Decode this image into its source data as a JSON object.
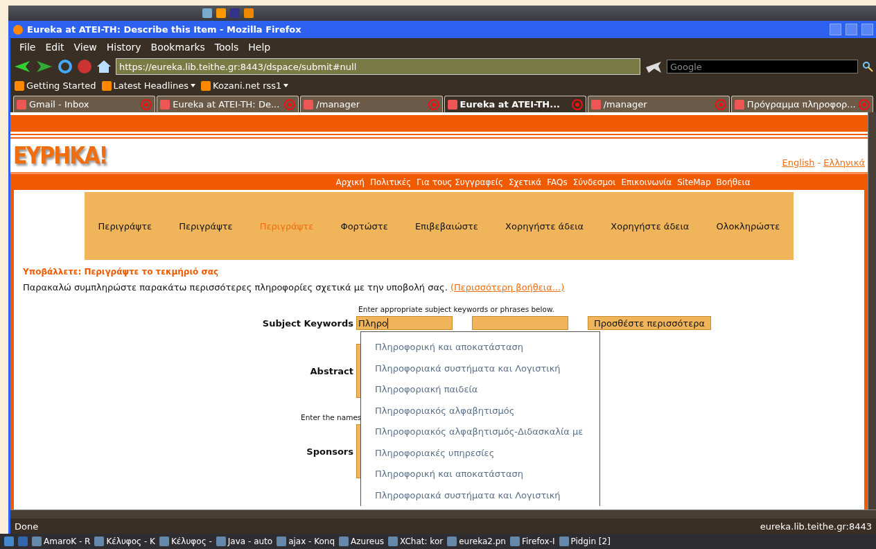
{
  "window": {
    "title": "Eureka at ATEI-TH: Describe this Item - Mozilla Firefox"
  },
  "menu": [
    "File",
    "Edit",
    "View",
    "History",
    "Bookmarks",
    "Tools",
    "Help"
  ],
  "navigation": {
    "url": "https://eureka.lib.teithe.gr:8443/dspace/submit#null",
    "search_placeholder": "Google"
  },
  "bookmarks": [
    {
      "label": "Getting Started",
      "has_menu": false
    },
    {
      "label": "Latest Headlines",
      "has_menu": true
    },
    {
      "label": "Kozani.net rss1",
      "has_menu": true
    }
  ],
  "tabs": [
    {
      "label": "Gmail - Inbox",
      "selected": false
    },
    {
      "label": "Eureka at ATEI-TH: De...",
      "selected": false
    },
    {
      "label": "/manager",
      "selected": false
    },
    {
      "label": "Eureka at ATEI-TH...",
      "selected": true
    },
    {
      "label": "/manager",
      "selected": false
    },
    {
      "label": "Πρόγραμμα πληροφορ...",
      "selected": false
    }
  ],
  "page": {
    "logo": "ΕΥΡΗΚΑ!",
    "languages": {
      "first": "English",
      "separator": "-",
      "second": "Ελληνικά"
    },
    "nav_links": [
      "Αρχική",
      "Πολιτικές",
      "Για τους Συγγραφείς",
      "Σχετικά",
      "FAQs",
      "Σύνδεσμοι",
      "Επικοινωνία",
      "SiteMap",
      "Βοήθεια"
    ],
    "steps": [
      {
        "label": "Περιγράψτε",
        "selected": false
      },
      {
        "label": "Περιγράψτε",
        "selected": false
      },
      {
        "label": "Περιγράψτε",
        "selected": true
      },
      {
        "label": "Φορτώστε",
        "selected": false
      },
      {
        "label": "Επιβεβαιώστε",
        "selected": false
      },
      {
        "label": "Χορηγήστε άδεια",
        "selected": false
      },
      {
        "label": "Χορηγήστε άδεια",
        "selected": false
      },
      {
        "label": "Ολοκληρώστε",
        "selected": false
      }
    ],
    "heading": "Υποβάλλετε: Περιγράψτε το τεκμήριό σας",
    "intro": "Παρακαλώ συμπληρώστε παρακάτω περισσότερες πληροφορίες σχετικά με την υποβολή σας.",
    "help_link": "(Περισσότερη βοήθεια...)",
    "keywords": {
      "hint": "Enter appropriate subject keywords or phrases below.",
      "label": "Subject Keywords",
      "value": "Πληρο",
      "button": "Προσθέστε περισσότερα"
    },
    "suggestions": [
      "Πληροφορική και αποκατάσταση",
      "Πληροφοριακά συστήματα και Λογιστική",
      "Πληροφοριακή παιδεία",
      "Πληροφοριακός αλφαβητισμός",
      "Πληροφοριακός αλφαβητισμός-Διδασκαλία με",
      "Πληροφοριακές υπηρεσίες",
      "Πληροφορική και αποκατάσταση",
      "Πληροφοριακά συστήματα και Λογιστική"
    ],
    "abstract": {
      "label": "Abstract"
    },
    "sponsors": {
      "hint": "Enter the names",
      "label": "Sponsors"
    }
  },
  "status_bar": {
    "text": "Done",
    "host": "eureka.lib.teithe.gr:8443"
  },
  "taskbar": [
    "AmaroK - R",
    "Κέλυφος - K",
    "Κέλυφος - ",
    "Java - auto",
    "ajax - Konq",
    "Azureus",
    "XChat: kor",
    "eureka2.pn",
    "Firefox-I",
    "Pidgin [2]"
  ]
}
